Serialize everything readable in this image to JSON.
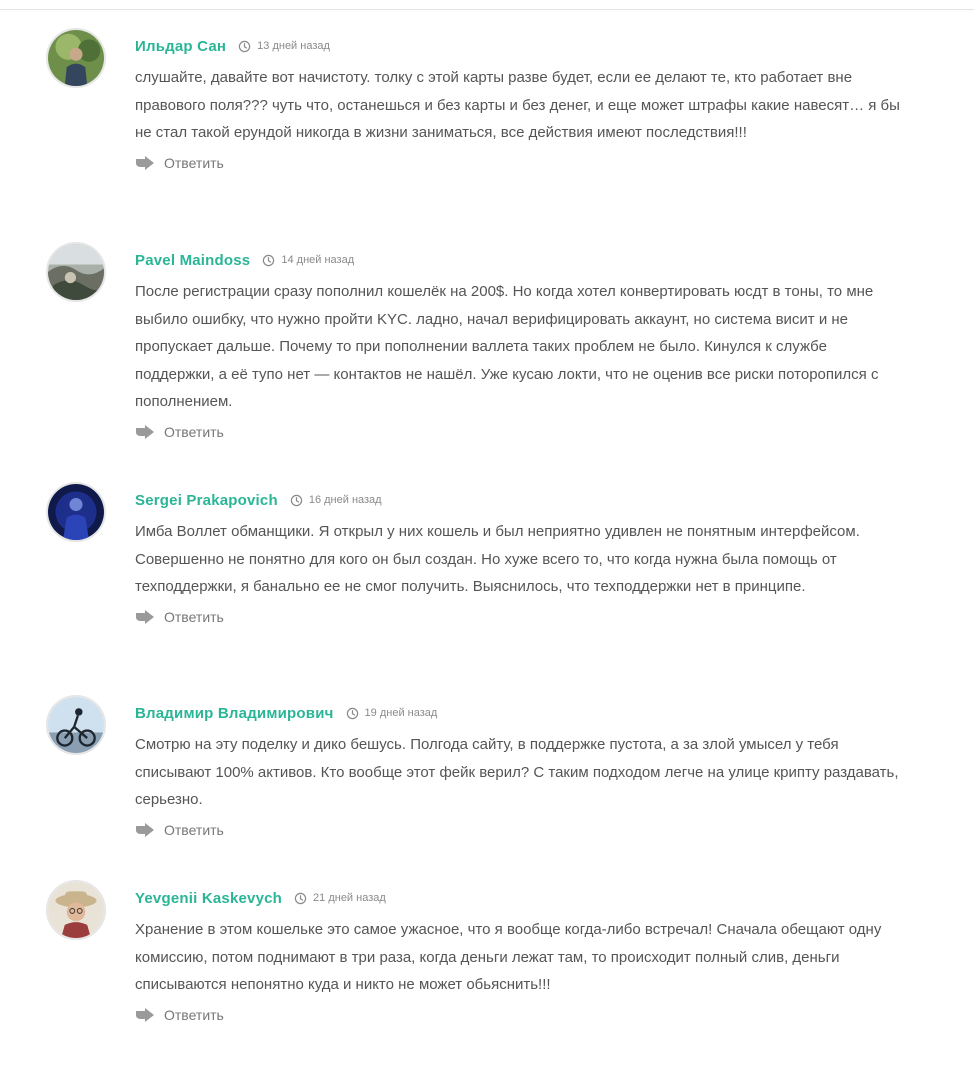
{
  "colors": {
    "author": "#2bb597",
    "text": "#555555",
    "meta": "#8a8a8a",
    "reply": "#777777"
  },
  "icons": {
    "date": "clock-icon",
    "reply": "reply-arrow-icon"
  },
  "comments": [
    {
      "author": "Ильдар Сан",
      "date": "13 дней назад",
      "text": "слушайте, давайте вот начистоту. толку с этой карты разве будет, если ее делают те, кто работает вне правового поля??? чуть что, останешься и без карты и без денег, и еще может штрафы какие навесят… я бы не стал такой ерундой никогда в жизни заниматься, все действия имеют последствия!!!",
      "reply": "Ответить"
    },
    {
      "author": "Pavel Maindoss",
      "date": "14 дней назад",
      "text": "После регистрации сразу пополнил кошелёк на 200$. Но когда хотел конвертировать юсдт в тоны, то мне выбило ошибку, что нужно пройти KYC. ладно, начал верифицировать аккаунт, но система висит и не пропускает дальше. Почему то при пополнении валлета таких проблем не было. Кинулся к службе поддержки, а её тупо нет — контактов не нашёл. Уже кусаю локти, что не оценив все риски поторопился с пополнением.",
      "reply": "Ответить"
    },
    {
      "author": "Sergei Prakapovich",
      "date": "16 дней назад",
      "text": "Имба Воллет обманщики. Я открыл у них кошель и был неприятно удивлен не понятным интерфейсом. Совершенно не понятно для кого он был создан. Но хуже всего то, что когда нужна была помощь от техподдержки, я банально ее не смог получить. Выяснилось, что техподдержки нет в принципе.",
      "reply": "Ответить"
    },
    {
      "author": "Владимир Владимирович",
      "date": "19 дней назад",
      "text": "Смотрю на эту поделку и дико бешусь. Полгода сайту, в поддержке пустота, а за злой умысел у тебя списывают 100% активов. Кто вообще этот фейк верил? С таким подходом легче на улице крипту раздавать, серьезно.",
      "reply": "Ответить"
    },
    {
      "author": "Yevgenii Kaskevych",
      "date": "21 дней назад",
      "text": "Хранение в этом кошельке это самое ужасное, что я вообще когда-либо встречал! Сначала обещают одну комиссию, потом поднимают в три раза, когда деньги лежат там, то происходит полный слив, деньги списываются непонятно куда и никто не может обьяснить!!!",
      "reply": "Ответить"
    }
  ]
}
